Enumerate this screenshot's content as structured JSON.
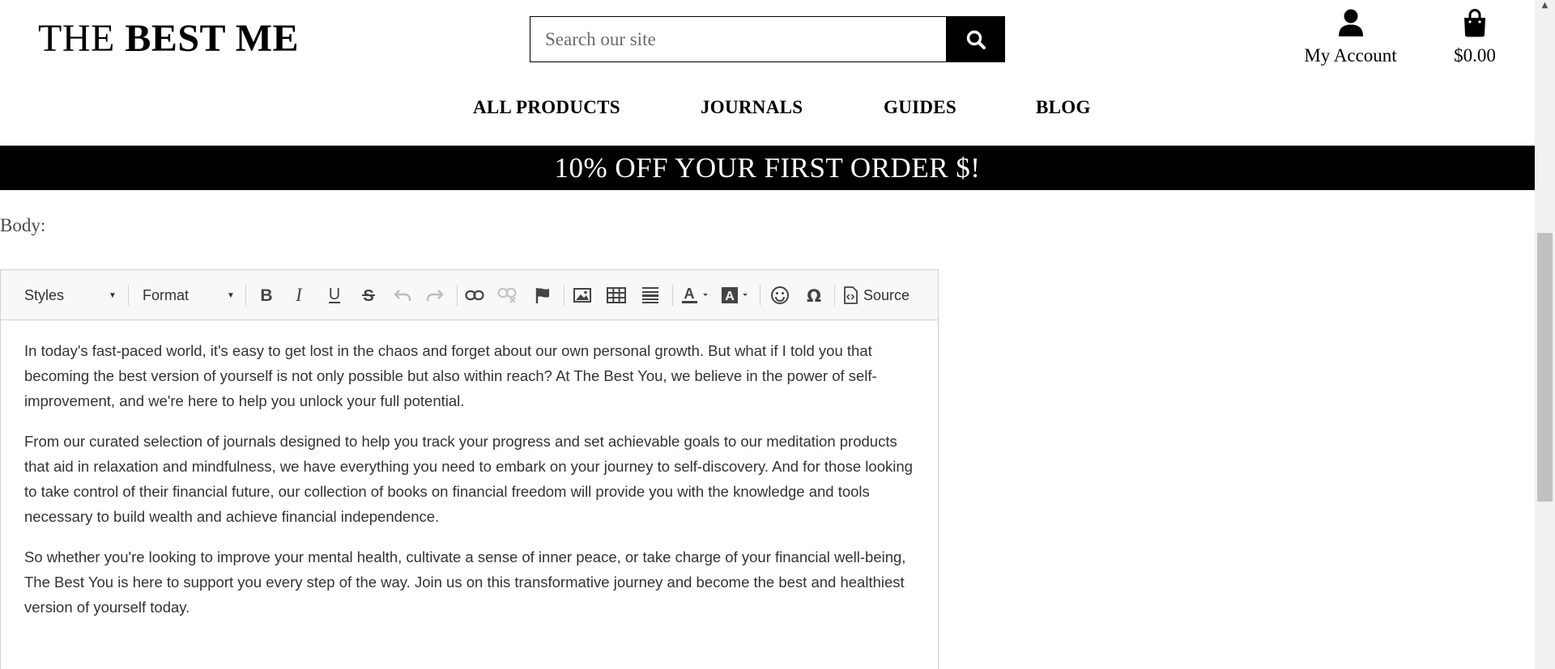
{
  "header": {
    "logo_regular": "THE",
    "logo_bold": "BEST ME",
    "search_placeholder": "Search our site",
    "account_label": "My Account",
    "cart_total": "$0.00",
    "icons": {
      "search": "search-icon",
      "account": "user-icon",
      "cart": "shopping-bag-icon"
    }
  },
  "nav": {
    "items": [
      "ALL PRODUCTS",
      "JOURNALS",
      "GUIDES",
      "BLOG"
    ]
  },
  "promo": {
    "text": "10% OFF YOUR FIRST ORDER $!"
  },
  "form": {
    "body_label": "Body:"
  },
  "editor": {
    "toolbar": {
      "styles_label": "Styles",
      "format_label": "Format",
      "source_label": "Source",
      "icons": [
        "bold-icon",
        "italic-icon",
        "underline-icon",
        "strikethrough-icon",
        "undo-icon",
        "redo-icon",
        "link-icon",
        "unlink-icon",
        "anchor-flag-icon",
        "image-icon",
        "table-icon",
        "horizontal-line-icon",
        "text-color-icon",
        "background-color-icon",
        "smiley-icon",
        "special-char-icon",
        "source-icon"
      ]
    },
    "paragraphs": [
      "In today's fast-paced world, it's easy to get lost in the chaos and forget about our own personal growth. But what if I told you that becoming the best version of yourself is not only possible but also within reach? At The Best You, we believe in the power of self-improvement, and we're here to help you unlock your full potential.",
      "From our curated selection of journals designed to help you track your progress and set achievable goals to our meditation products that aid in relaxation and mindfulness, we have everything you need to embark on your journey to self-discovery. And for those looking to take control of their financial future, our collection of books on financial freedom will provide you with the knowledge and tools necessary to build wealth and achieve financial independence.",
      "So whether you're looking to improve your mental health, cultivate a sense of inner peace, or take charge of your financial well-being, The Best You is here to support you every step of the way. Join us on this transformative journey and become the best and healthiest version of yourself today."
    ]
  },
  "colors": {
    "promo_background": "#000000",
    "toolbar_background": "#f8f8f8",
    "editor_text": "#333333"
  }
}
